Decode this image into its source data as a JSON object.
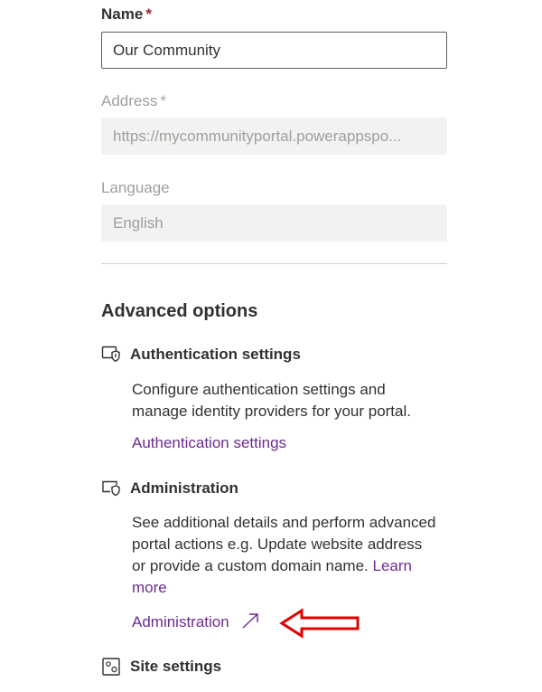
{
  "form": {
    "name": {
      "label": "Name",
      "required_mark": "*",
      "value": "Our Community"
    },
    "address": {
      "label": "Address",
      "required_mark": "*",
      "value": "https://mycommunityportal.powerappspo..."
    },
    "language": {
      "label": "Language",
      "value": "English"
    }
  },
  "advanced": {
    "title": "Advanced options",
    "authentication": {
      "heading": "Authentication settings",
      "icon": "authentication-shield-icon",
      "description": "Configure authentication settings and manage identity providers for your portal.",
      "link_label": "Authentication settings"
    },
    "administration": {
      "heading": "Administration",
      "icon": "administration-shield-icon",
      "description": "See additional details and perform advanced portal actions e.g. Update website address or provide a custom domain name.",
      "learn_more": "Learn more",
      "link_label": "Administration",
      "link_icon": "external-link-icon"
    },
    "site_settings": {
      "heading": "Site settings",
      "icon": "site-settings-icon"
    }
  },
  "annotation": {
    "arrow_color": "#e00000"
  },
  "colors": {
    "link": "#6b2c8f",
    "required": "#a4262c"
  }
}
